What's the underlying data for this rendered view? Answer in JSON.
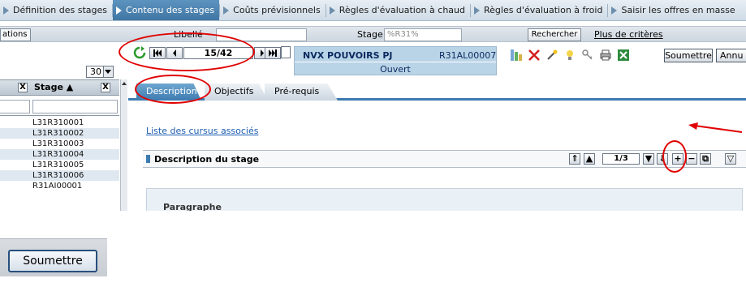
{
  "nav": {
    "tabs": [
      {
        "label": "Définition des stages",
        "active": false
      },
      {
        "label": "Contenu des stages",
        "active": true
      },
      {
        "label": "Coûts prévisionnels",
        "active": false
      },
      {
        "label": "Règles d'évaluation à chaud",
        "active": false
      },
      {
        "label": "Règles d'évaluation à froid",
        "active": false
      },
      {
        "label": "Saisir les offres en masse",
        "active": false
      }
    ]
  },
  "filter": {
    "left_tab_label": "ations",
    "libelle_label": "Libellé",
    "libelle_value": "",
    "stage_label": "Stage",
    "stage_value": "%R31%",
    "search_button": "Rechercher",
    "more_criteria_link": "Plus de critères"
  },
  "pager": {
    "page_display": "15/42",
    "page_size": "30"
  },
  "record": {
    "title": "NVX POUVOIRS PJ",
    "code": "R31AL00007",
    "status": "Ouvert"
  },
  "toolbar": {
    "submit_label": "Soumettre",
    "cancel_label": "Annu"
  },
  "grid": {
    "column_header": "Stage ▲",
    "clear_label": "X",
    "rows": [
      "L31R310001",
      "L31R310002",
      "L31R310003",
      "L31R310004",
      "L31R310005",
      "L31R310006",
      "R31AI00001"
    ]
  },
  "content": {
    "tabs": [
      "Description",
      "Objectifs",
      "Pré-requis"
    ],
    "active_tab": "Description",
    "cursus_link": "Liste des cursus associés",
    "section_title": "Description du stage",
    "section_page": "1/3",
    "paragraph_label": "Paragraphe"
  },
  "zoom": {
    "button_label": "Soumettre"
  },
  "colors": {
    "active_tab": "#3d7bb0",
    "info_bar": "#b9d3e7",
    "annotation_red": "#e00000"
  },
  "icons": [
    "refresh-icon",
    "first-page-icon",
    "prev-page-icon",
    "next-page-icon",
    "last-page-icon",
    "new-doc-icon",
    "columns-icon",
    "delete-icon",
    "wand-icon",
    "bulb-icon",
    "key-icon",
    "print-icon",
    "excel-icon",
    "filter-icon",
    "copy-icon",
    "red-arrow-icon"
  ]
}
